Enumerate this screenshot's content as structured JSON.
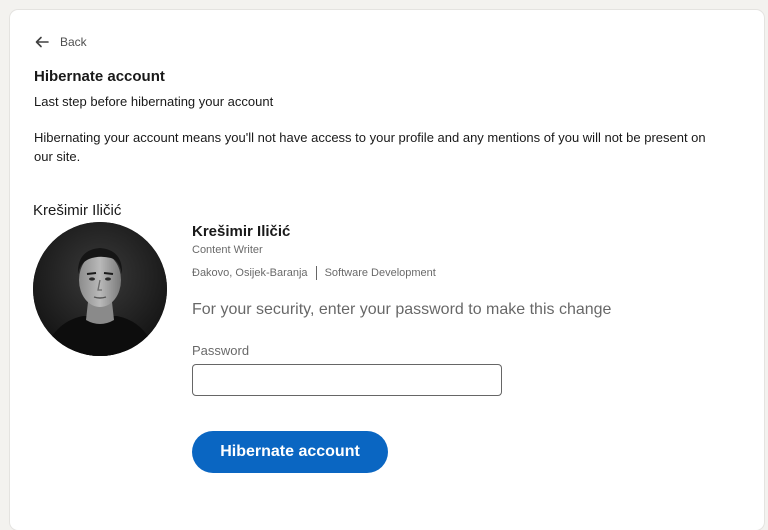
{
  "nav": {
    "back_label": "Back",
    "back_icon": "arrow-left-icon"
  },
  "header": {
    "title": "Hibernate account",
    "subtitle": "Last step before hibernating your account"
  },
  "description": "Hibernating your account means you'll not have access to your profile and any mentions of you will not be present on our site.",
  "member": {
    "name_label": "Krešimir Iličić"
  },
  "profile": {
    "name": "Krešimir Iličić",
    "headline": "Content Writer",
    "location": "Đakovo, Osijek-Baranja",
    "industry": "Software Development"
  },
  "security": {
    "prompt": "For your security, enter your password to make this change",
    "password_label": "Password",
    "password_value": "",
    "password_placeholder": ""
  },
  "actions": {
    "primary_label": "Hibernate account"
  },
  "colors": {
    "primary": "#0a66c2",
    "background": "#f3f2ef",
    "card": "#ffffff"
  }
}
